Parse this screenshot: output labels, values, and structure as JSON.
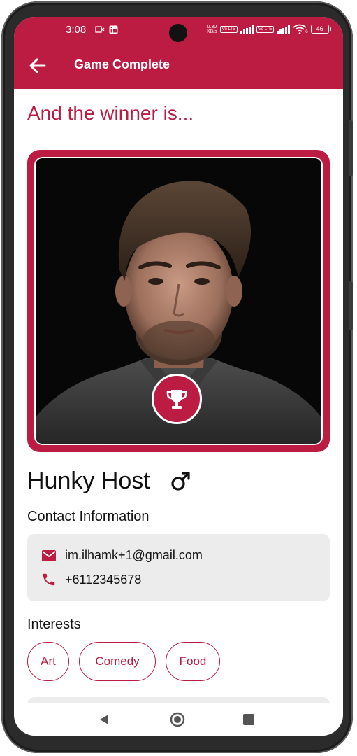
{
  "status_bar": {
    "time": "3:08",
    "net_speed_value": "0.30",
    "net_speed_unit": "KB/s",
    "volte_1": "Vo LTE",
    "volte_2": "Vo LTE",
    "wifi_label": "6",
    "battery": "46",
    "notification_icons": [
      "dx-icon",
      "linkedin-icon"
    ]
  },
  "app_bar": {
    "title": "Game Complete",
    "back_icon": "arrow-left-icon"
  },
  "main": {
    "headline": "And the winner is...",
    "winner_name": "Hunky Host",
    "gender_icon": "male-icon",
    "badge_icon": "trophy-icon",
    "contact_label": "Contact Information",
    "email": "im.ilhamk+1@gmail.com",
    "phone": "+6112345678",
    "interests_label": "Interests",
    "interests": [
      "Art",
      "Comedy",
      "Food"
    ]
  },
  "colors": {
    "brand": "#bc1b42",
    "card_background": "#ececec"
  },
  "system_nav": [
    "back-triangle-icon",
    "home-circle-icon",
    "recents-square-icon"
  ]
}
